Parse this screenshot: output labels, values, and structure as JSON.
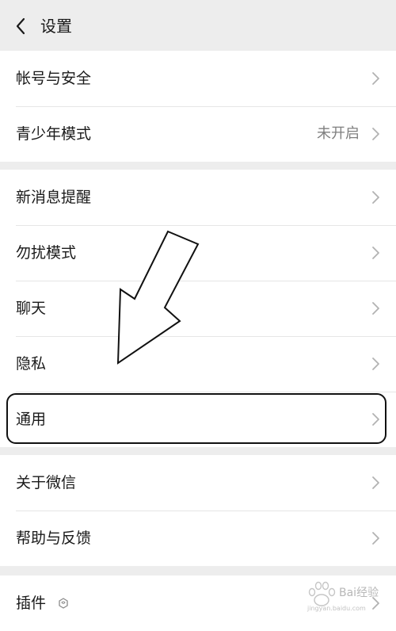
{
  "header": {
    "title": "设置"
  },
  "groups": [
    {
      "items": [
        {
          "label": "帐号与安全"
        },
        {
          "label": "青少年模式",
          "value": "未开启"
        }
      ]
    },
    {
      "items": [
        {
          "label": "新消息提醒"
        },
        {
          "label": "勿扰模式"
        },
        {
          "label": "聊天"
        },
        {
          "label": "隐私"
        },
        {
          "label": "通用"
        }
      ]
    },
    {
      "items": [
        {
          "label": "关于微信"
        },
        {
          "label": "帮助与反馈"
        }
      ]
    },
    {
      "items": [
        {
          "label": "插件"
        }
      ]
    }
  ],
  "watermark": {
    "brand": "Bai经验",
    "url": "jingyan.baidu.com"
  },
  "colors": {
    "background": "#ededed",
    "row_background": "#ffffff",
    "text": "#1a1a1a",
    "secondary_text": "#7f7f7f",
    "chevron": "#b2b2b2"
  }
}
